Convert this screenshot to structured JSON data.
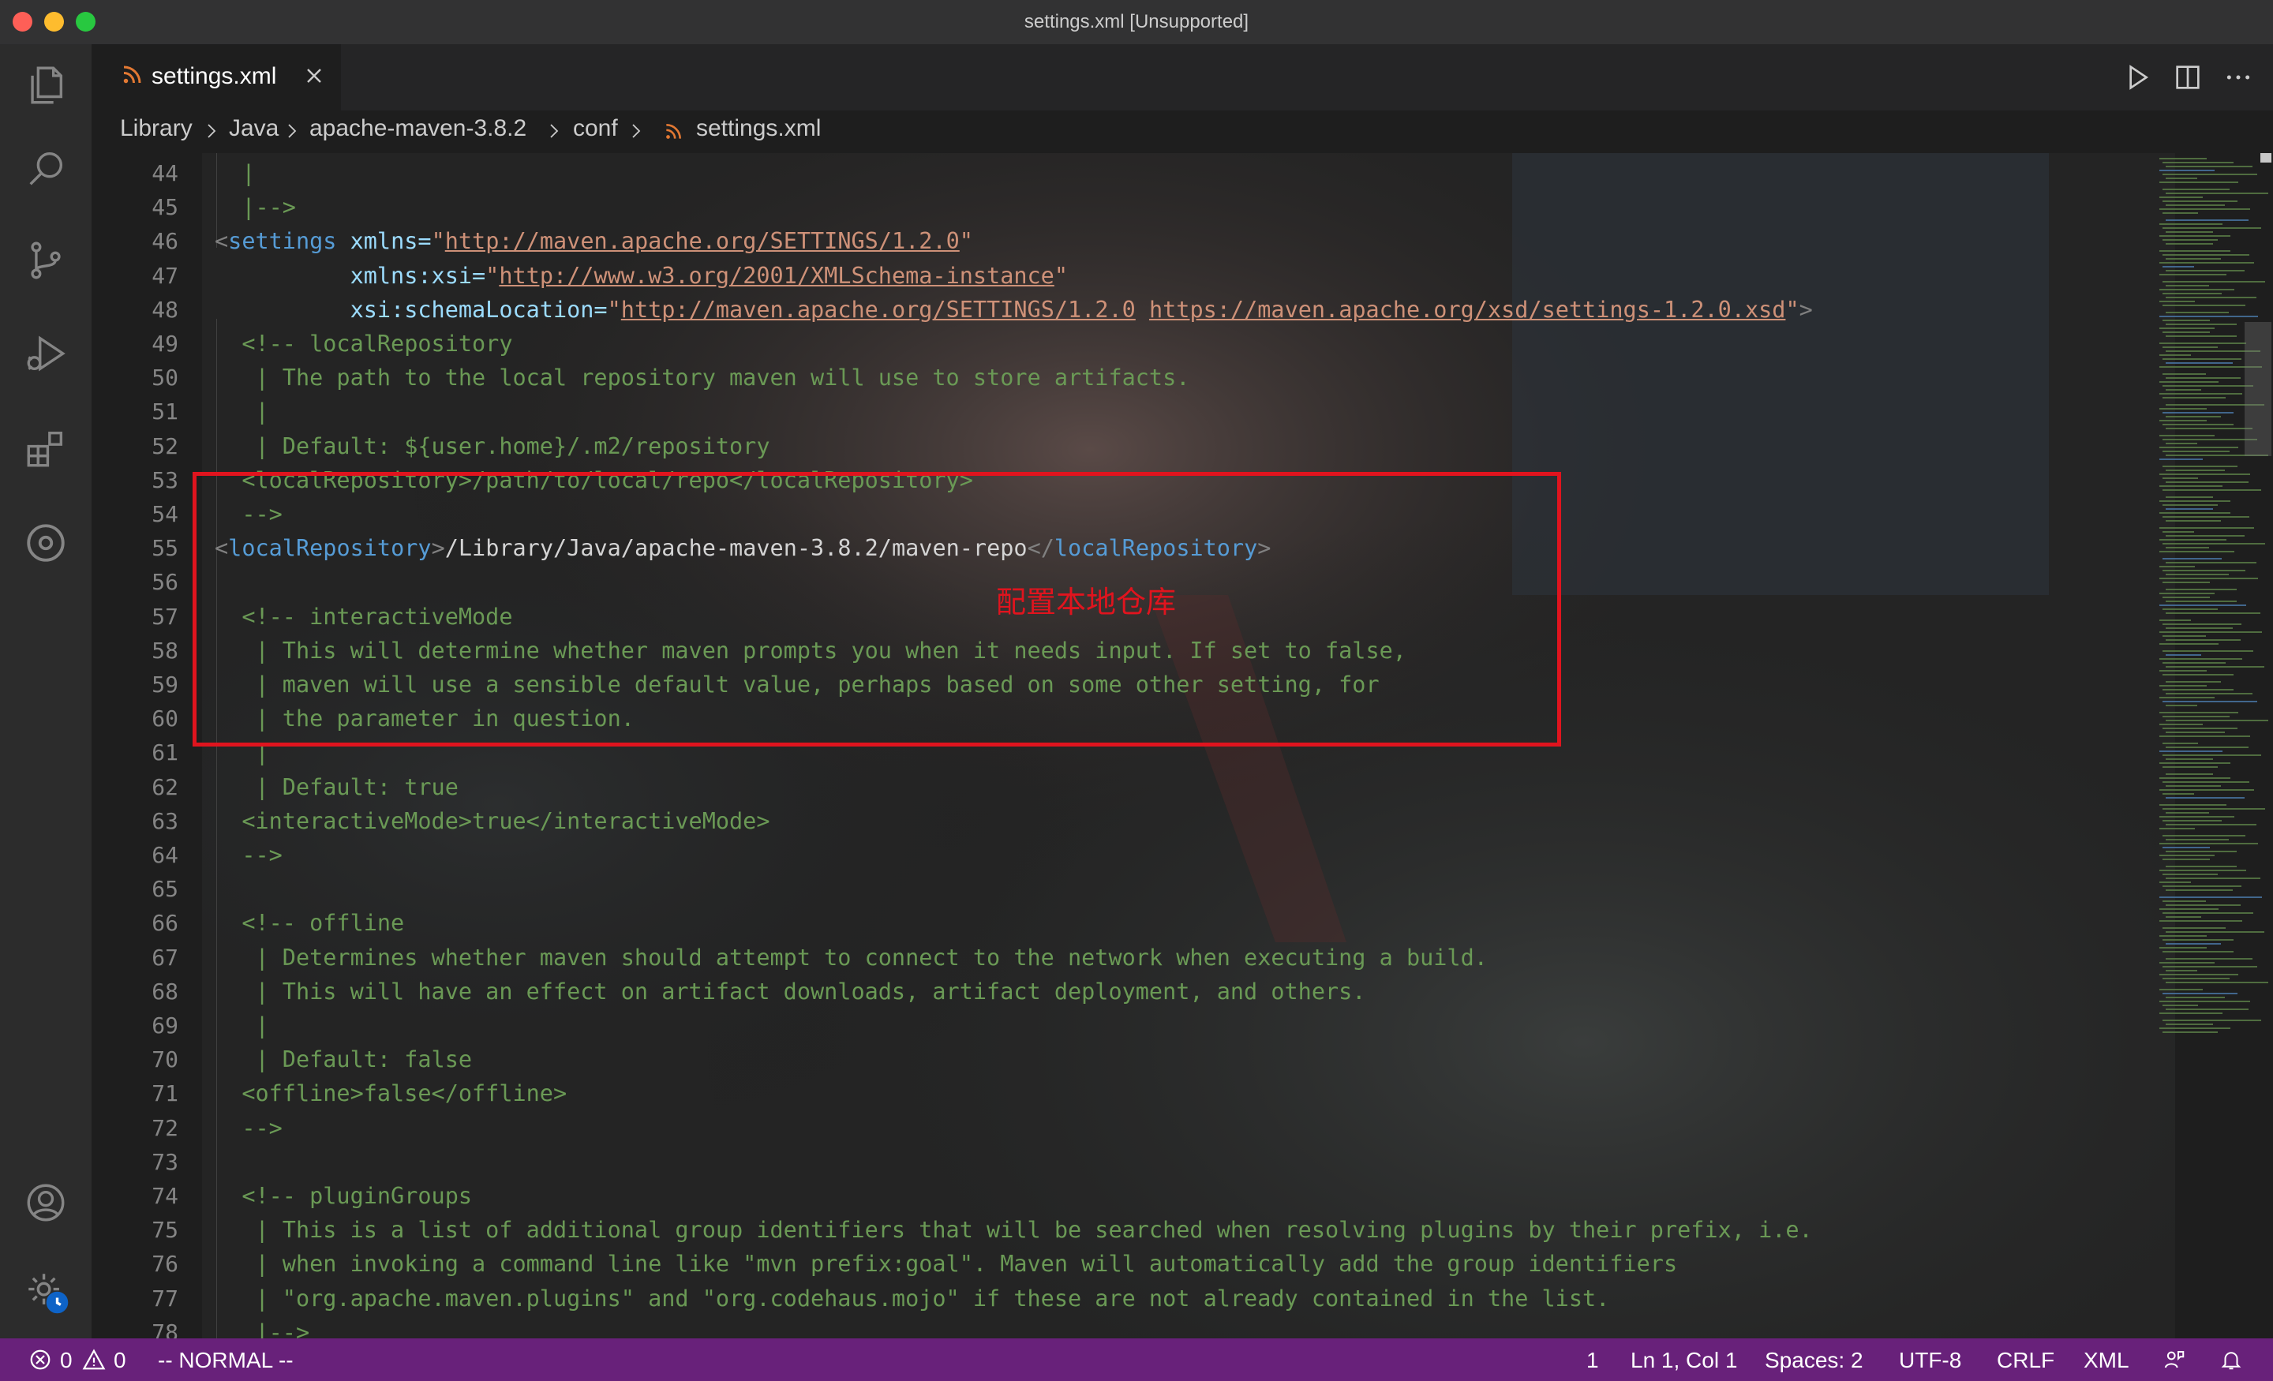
{
  "window": {
    "title": "settings.xml [Unsupported]"
  },
  "activity_bar": {
    "items": [
      "explorer-icon",
      "search-icon",
      "source-control-icon",
      "run-debug-icon",
      "extensions-icon",
      "remote-icon"
    ],
    "bottom_items": [
      "account-icon",
      "settings-gear-icon"
    ]
  },
  "tab": {
    "label": "settings.xml",
    "icon": "rss-icon",
    "icon_color": "#e37933"
  },
  "breadcrumb": {
    "items": [
      "Library",
      "Java",
      "apache-maven-3.8.2",
      "conf",
      "settings.xml"
    ]
  },
  "editor": {
    "line_numbers": [
      "44",
      "45",
      "46",
      "47",
      "48",
      "49",
      "50",
      "51",
      "52",
      "53",
      "54",
      "55",
      "56",
      "57",
      "58",
      "59",
      "60",
      "61",
      "62",
      "63",
      "64",
      "65",
      "66",
      "67",
      "68",
      "69",
      "70",
      "71",
      "72",
      "73",
      "74",
      "75",
      "76",
      "77",
      "78"
    ],
    "lines": {
      "l44": "  |",
      "l45": "  |-->",
      "l46_bracket": "<",
      "l46_tag": "settings",
      "l46_attr": " xmlns=",
      "l46_q1": "\"",
      "l46_url": "http://maven.apache.org/SETTINGS/1.2.0",
      "l46_q2": "\"",
      "l47_attr": "          xmlns:xsi=",
      "l47_q1": "\"",
      "l47_url": "http://www.w3.org/2001/XMLSchema-instance",
      "l47_q2": "\"",
      "l48_attr": "          xsi:schemaLocation=",
      "l48_q1": "\"",
      "l48_url1": "http://maven.apache.org/SETTINGS/1.2.0",
      "l48_sp": " ",
      "l48_url2": "https://maven.apache.org/xsd/settings-1.2.0.xsd",
      "l48_q2": "\"",
      "l48_end": ">",
      "l49": "  <!-- localRepository",
      "l50": "   | The path to the local repository maven will use to store artifacts.",
      "l51": "   |",
      "l52": "   | Default: ${user.home}/.m2/repository",
      "l53": "  <localRepository>/path/to/local/repo</localRepository>",
      "l54": "  -->",
      "l55_open_b": "<",
      "l55_open_t": "localRepository",
      "l55_open_e": ">",
      "l55_value": "/Library/Java/apache-maven-3.8.2/maven-repo",
      "l55_close_b": "</",
      "l55_close_t": "localRepository",
      "l55_close_e": ">",
      "l57": "  <!-- interactiveMode",
      "l58": "   | This will determine whether maven prompts you when it needs input. If set to false,",
      "l59": "   | maven will use a sensible default value, perhaps based on some other setting, for",
      "l60": "   | the parameter in question.",
      "l61": "   |",
      "l62": "   | Default: true",
      "l63": "  <interactiveMode>true</interactiveMode>",
      "l64": "  -->",
      "l66": "  <!-- offline",
      "l67": "   | Determines whether maven should attempt to connect to the network when executing a build.",
      "l68": "   | This will have an effect on artifact downloads, artifact deployment, and others.",
      "l69": "   |",
      "l70": "   | Default: false",
      "l71": "  <offline>false</offline>",
      "l72": "  -->",
      "l74": "  <!-- pluginGroups",
      "l75": "   | This is a list of additional group identifiers that will be searched when resolving plugins by their prefix, i.e.",
      "l76": "   | when invoking a command line like \"mvn prefix:goal\". Maven will automatically add the group identifiers",
      "l77": "   | \"org.apache.maven.plugins\" and \"org.codehaus.mojo\" if these are not already contained in the list.",
      "l78": "   |-->"
    },
    "annotation": "配置本地仓库",
    "annotation_color": "#e0141e"
  },
  "statusbar": {
    "errors": "0",
    "warnings": "0",
    "mode": "-- NORMAL --",
    "count": "1",
    "position": "Ln 1, Col 1",
    "spaces": "Spaces: 2",
    "encoding": "UTF-8",
    "eol": "CRLF",
    "language": "XML",
    "background": "#68217a"
  }
}
